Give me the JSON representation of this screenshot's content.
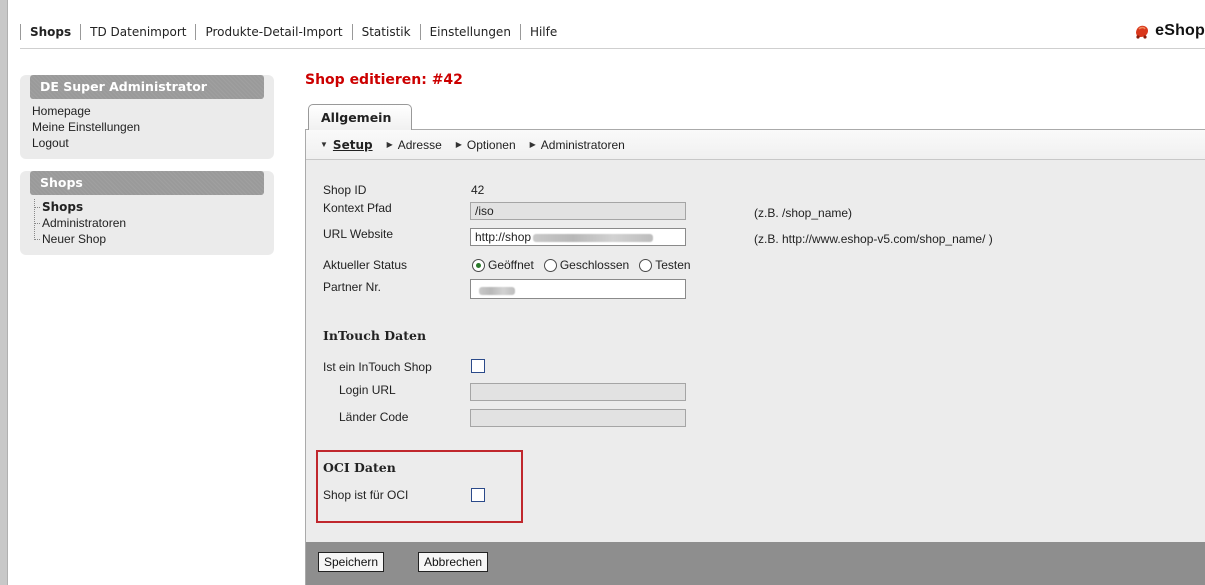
{
  "topnav": {
    "items": [
      {
        "label": "Shops",
        "active": true
      },
      {
        "label": "TD Datenimport"
      },
      {
        "label": "Produkte-Detail-Import"
      },
      {
        "label": "Statistik"
      },
      {
        "label": "Einstellungen"
      },
      {
        "label": "Hilfe"
      }
    ],
    "brand": "eShop",
    "brand_color": "#d9371c"
  },
  "sidebar": {
    "user_box": {
      "title": "DE Super Administrator",
      "links": [
        "Homepage",
        "Meine Einstellungen",
        "Logout"
      ]
    },
    "shops_box": {
      "title": "Shops",
      "items": [
        {
          "label": "Shops",
          "active": true
        },
        {
          "label": "Administratoren"
        },
        {
          "label": "Neuer Shop"
        }
      ]
    }
  },
  "main": {
    "title": "Shop editieren: #42",
    "title_color": "#cc0000",
    "tab": "Allgemein",
    "subnav": [
      {
        "label": "Setup",
        "active": true,
        "icon": "triangle-down-icon"
      },
      {
        "label": "Adresse",
        "icon": "triangle-right-icon"
      },
      {
        "label": "Optionen",
        "icon": "triangle-right-icon"
      },
      {
        "label": "Administratoren",
        "icon": "triangle-right-icon"
      }
    ],
    "form": {
      "shop_id_label": "Shop ID",
      "shop_id_value": "42",
      "kontext_label": "Kontext Pfad",
      "kontext_value": "/iso",
      "kontext_hint": "(z.B. /shop_name)",
      "url_label": "URL Website",
      "url_value": "http://shop",
      "url_hint": "(z.B. http://www.eshop-v5.com/shop_name/ )",
      "status_label": "Aktueller Status",
      "status_options": [
        "Geöffnet",
        "Geschlossen",
        "Testen"
      ],
      "status_selected": "Geöffnet",
      "partner_label": "Partner Nr."
    },
    "intouch": {
      "heading": "InTouch Daten",
      "is_shop_label": "Ist ein InTouch Shop",
      "is_shop_checked": false,
      "login_url_label": "Login URL",
      "laender_label": "Länder Code"
    },
    "oci": {
      "heading": "OCI Daten",
      "label": "Shop ist für OCI",
      "checked": false,
      "highlight_color": "#c0272d"
    },
    "buttons": {
      "save": "Speichern",
      "cancel": "Abbrechen"
    }
  }
}
